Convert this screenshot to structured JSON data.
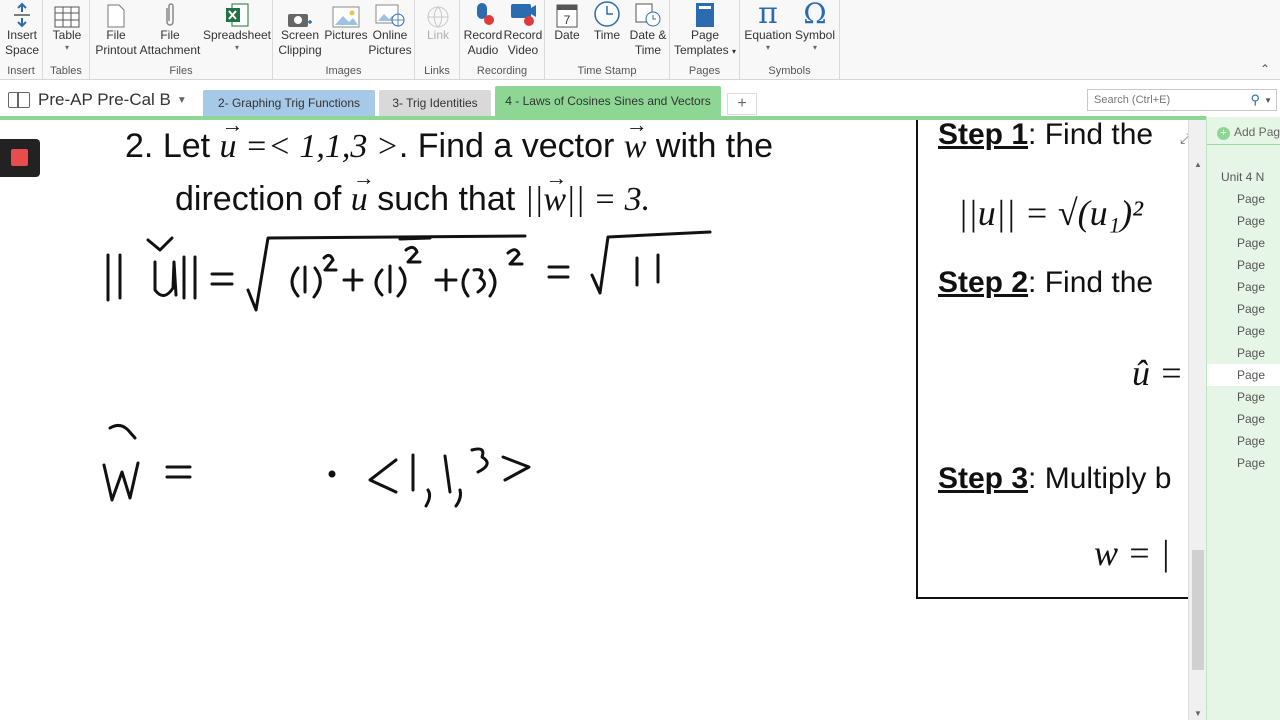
{
  "ribbon": {
    "groups": {
      "insert": {
        "label": "Insert",
        "buttons": {
          "insert_space": "Insert\nSpace"
        }
      },
      "tables": {
        "label": "Tables",
        "buttons": {
          "table": "Table"
        }
      },
      "files": {
        "label": "Files",
        "buttons": {
          "file_printout": "File\nPrintout",
          "file_attachment": "File\nAttachment",
          "spreadsheet": "Spreadsheet"
        }
      },
      "images": {
        "label": "Images",
        "buttons": {
          "screen_clipping": "Screen\nClipping",
          "pictures": "Pictures",
          "online_pictures": "Online\nPictures"
        }
      },
      "links": {
        "label": "Links",
        "buttons": {
          "link": "Link"
        }
      },
      "recording": {
        "label": "Recording",
        "buttons": {
          "record_audio": "Record\nAudio",
          "record_video": "Record\nVideo"
        }
      },
      "timestamp": {
        "label": "Time Stamp",
        "buttons": {
          "date": "Date",
          "time": "Time",
          "date_time": "Date &\nTime"
        }
      },
      "pages": {
        "label": "Pages",
        "buttons": {
          "page_templates": "Page\nTemplates"
        }
      },
      "symbols": {
        "label": "Symbols",
        "buttons": {
          "equation": "Equation",
          "symbol": "Symbol"
        }
      }
    }
  },
  "notebook": {
    "title": "Pre-AP Pre-Cal B"
  },
  "tabs": [
    {
      "label": "2- Graphing Trig Functions",
      "color": "#a6c9e8"
    },
    {
      "label": "3- Trig Identities",
      "color": "#d9d9d9"
    },
    {
      "label": "4 - Laws of Cosines Sines and Vectors",
      "color": "#8ed694"
    }
  ],
  "search": {
    "placeholder": "Search (Ctrl+E)"
  },
  "problem": {
    "number": "2.",
    "line1_a": "Let ",
    "u": "u",
    "line1_b": " =< 1,1,3 >",
    "line1_c": ". Find a vector ",
    "w": "w",
    "line1_d": " with the",
    "line2_a": "direction of ",
    "line2_b": " such that ",
    "line2_c": " = 3."
  },
  "reference": {
    "step1_label": "Step 1",
    "step1_text": ": Find the",
    "step2_label": "Step 2",
    "step2_text": ": Find the",
    "step3_label": "Step 3",
    "step3_text": ": Multiply b",
    "formula1": "||u|| = √(u₁)²",
    "formula2": "û =",
    "formula3": "w = |"
  },
  "pages_pane": {
    "add_page": "Add Pag",
    "items": [
      "Unit 4 N",
      "Page",
      "Page",
      "Page",
      "Page",
      "Page",
      "Page",
      "Page",
      "Page",
      "Page",
      "Page",
      "Page",
      "Page",
      "Page"
    ],
    "selected_index": 9
  }
}
